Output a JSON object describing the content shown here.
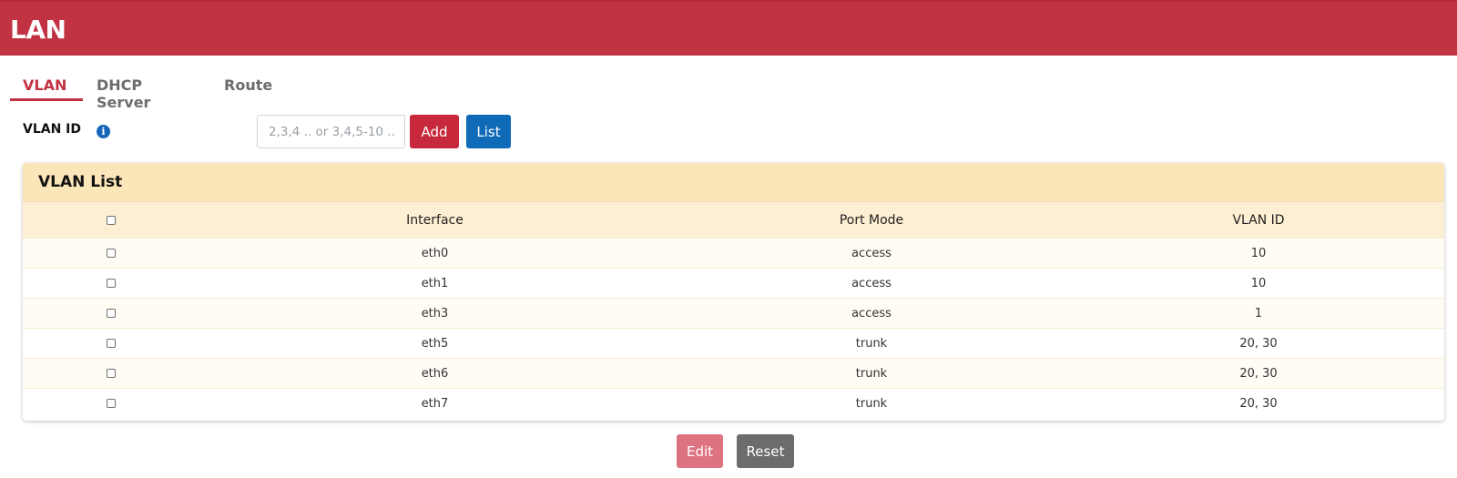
{
  "header": {
    "title": "LAN"
  },
  "tabs": [
    {
      "label": "VLAN",
      "active": true
    },
    {
      "label": "DHCP Server",
      "active": false
    },
    {
      "label": "Route",
      "active": false
    }
  ],
  "vlan_form": {
    "label": "VLAN ID",
    "info_icon": "info-icon",
    "input_value": "",
    "input_placeholder": "2,3,4 .. or 3,4,5-10 ..",
    "add_label": "Add",
    "list_label": "List"
  },
  "vlan_list": {
    "title": "VLAN List",
    "columns": [
      "Interface",
      "Port Mode",
      "VLAN ID"
    ],
    "rows": [
      {
        "interface": "eth0",
        "port_mode": "access",
        "vlan_id": "10"
      },
      {
        "interface": "eth1",
        "port_mode": "access",
        "vlan_id": "10"
      },
      {
        "interface": "eth3",
        "port_mode": "access",
        "vlan_id": "1"
      },
      {
        "interface": "eth5",
        "port_mode": "trunk",
        "vlan_id": "20, 30"
      },
      {
        "interface": "eth6",
        "port_mode": "trunk",
        "vlan_id": "20, 30"
      },
      {
        "interface": "eth7",
        "port_mode": "trunk",
        "vlan_id": "20, 30"
      }
    ]
  },
  "actions": {
    "edit_label": "Edit",
    "reset_label": "Reset"
  },
  "colors": {
    "brand": "#c13342",
    "add_button": "#c8283b",
    "list_button": "#0f6ab8",
    "edit_button": "#dd7381",
    "reset_button": "#6c6c6c",
    "card_header": "#fbe6b9"
  }
}
